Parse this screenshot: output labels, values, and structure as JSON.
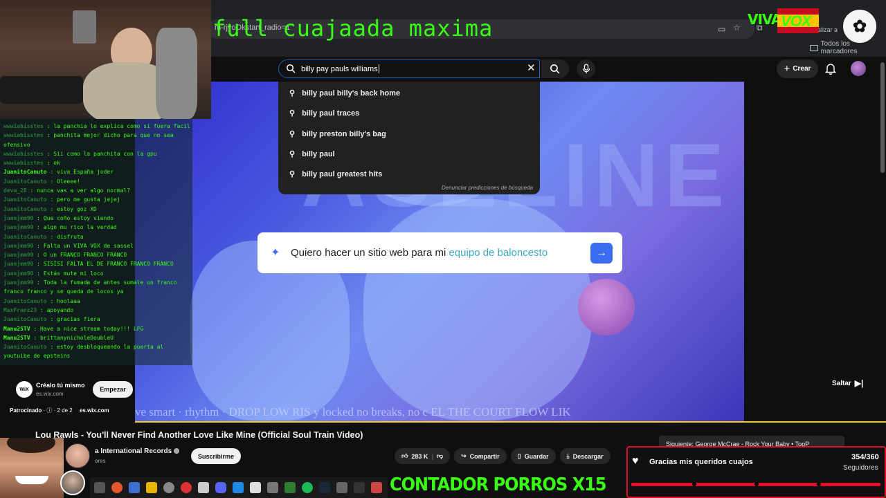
{
  "overlay": {
    "title": "full cuajaada maxima",
    "viva": "VIVA",
    "vox": "VOX",
    "porros": "CONTADOR PORROS X15"
  },
  "browser": {
    "url_fragment": "m-rjyoOkstart_radio=1",
    "personalize": "nalizar a",
    "bookmarks_label": "Todos los marcadores"
  },
  "search": {
    "query": "billy pay pauls williams",
    "suggestions": [
      "billy paul billy's back home",
      "billy paul traces",
      "billy preston billy's bag",
      "billy paul",
      "billy paul greatest hits"
    ],
    "report_text": "Denunciar predicciones de búsqueda"
  },
  "header": {
    "create_label": "Crear"
  },
  "ad": {
    "prompt_plain": "Quiero hacer un sitio web para mi ",
    "prompt_highlight": "equipo de baloncesto",
    "ticker": "ve smart · rhythm · DROP LOW RIS       y locked no breaks, no c      EL THE COURT FLOW LIK",
    "skip_label": "Saltar",
    "wix_logo": "WiX",
    "wix_title": "Créalo tú mismo",
    "wix_url": "es.wix.com",
    "start_label": "Empezar",
    "sponsored": "Patrocinado",
    "sponsored_count": "2 de 2",
    "sponsored_url": "es.wix.com"
  },
  "video": {
    "title": "Lou Rawls - You'll Never Find Another Love Like Mine (Official Soul Train Video)",
    "channel": "a International Records",
    "subs": "ores",
    "subscribe_label": "Suscribirme",
    "likes": "283 K",
    "share_label": "Compartir",
    "save_label": "Guardar",
    "download_label": "Descargar",
    "next_up": "Siguiente: George McCrae - Rock Your Baby • TopP"
  },
  "followers": {
    "message": "Gracias mis queridos cuajos",
    "count": "354/360",
    "label": "Seguidores"
  },
  "chat": [
    {
      "user": "wwwiabisstes",
      "msg": "la panchia lo explica como si fuera facil",
      "dim": true
    },
    {
      "user": "wwwiabisstes",
      "msg": "panchita mejor dicho para que no sea ofensivo",
      "dim": true
    },
    {
      "user": "wwwiabisstes",
      "msg": "Sii como la panchita con la gpu",
      "dim": true
    },
    {
      "user": "wwwiabisstes",
      "msg": "ok",
      "dim": true
    },
    {
      "user": "JuanitoCanuto",
      "msg": "viva España joder",
      "dim": false
    },
    {
      "user": "JuanitoCanuto",
      "msg": "Oleeee!",
      "dim": true
    },
    {
      "user": "deva_28",
      "msg": "nunca vas a ver algo normal?",
      "dim": true
    },
    {
      "user": "JuanitoCanuto",
      "msg": "pero me gusta jejej",
      "dim": true
    },
    {
      "user": "JuanitoCanuto",
      "msg": "estoy goz XD",
      "dim": true
    },
    {
      "user": "juanjmm90",
      "msg": "Que coño estoy viendo",
      "dim": true
    },
    {
      "user": "juanjmm90",
      "msg": "algo mu rico la verdad",
      "dim": true
    },
    {
      "user": "JuanitoCanuto",
      "msg": "disfruta",
      "dim": true
    },
    {
      "user": "juanjmm90",
      "msg": "Falta un VIVA VOX de sassel",
      "dim": true
    },
    {
      "user": "juanjmm90",
      "msg": "O un FRANCO FRANCO FRANCO",
      "dim": true
    },
    {
      "user": "juanjmm90",
      "msg": "SISISI FALTA EL DE FRANCO FRANCO FRANCO",
      "dim": true
    },
    {
      "user": "juanjmm90",
      "msg": "Estás mute mi loco",
      "dim": true
    },
    {
      "user": "juanjmm90",
      "msg": "Toda la fumada de antes sumale un franco franco franco y se queda de locos ya",
      "dim": true
    },
    {
      "user": "JuanitoCanuto",
      "msg": "hoolaaa",
      "dim": true
    },
    {
      "user": "MaxFranz23",
      "msg": "apoyando",
      "dim": true
    },
    {
      "user": "JuanitoCanuto",
      "msg": "gracias fiera",
      "dim": true
    },
    {
      "user": "Manu2STV",
      "msg": "Have a nice stream today!!! LFG",
      "dim": false
    },
    {
      "user": "Manu2STV",
      "msg": "brittanynicholeDoubleU",
      "dim": false
    },
    {
      "user": "JuanitoCanuto",
      "msg": "estoy desbloqueando la puerta al youtuibe de epsteins",
      "dim": true
    }
  ],
  "colors": {
    "overlay_green": "#39ff14",
    "follower_red": "#e0102a",
    "progress_yellow": "#ffcc00"
  }
}
